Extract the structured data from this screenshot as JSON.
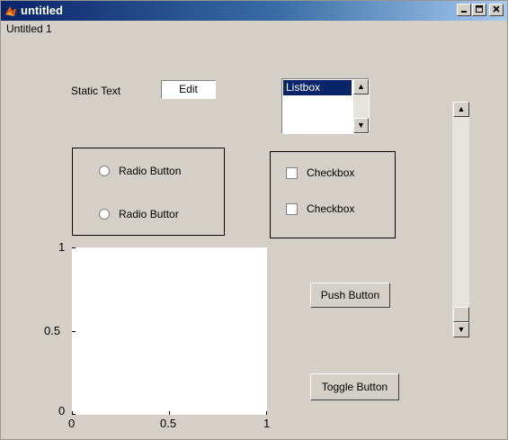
{
  "window": {
    "title": "untitled",
    "subtitle": "Untitled 1"
  },
  "controls": {
    "static_text": "Static Text",
    "edit_value": "Edit",
    "listbox_items": [
      "Listbox"
    ],
    "radio1": "Radio Button",
    "radio2": "Radio Buttor",
    "checkbox1": "Checkbox",
    "checkbox2": "Checkbox",
    "push_button": "Push Button",
    "toggle_button": "Toggle Button"
  },
  "chart_data": {
    "type": "line",
    "x": [],
    "y": [],
    "title": "",
    "xlabel": "",
    "ylabel": "",
    "xlim": [
      0,
      1
    ],
    "ylim": [
      0,
      1
    ],
    "xticks": [
      "0",
      "0.5",
      "1"
    ],
    "yticks": [
      "0",
      "0.5",
      "1"
    ],
    "grid": false
  }
}
